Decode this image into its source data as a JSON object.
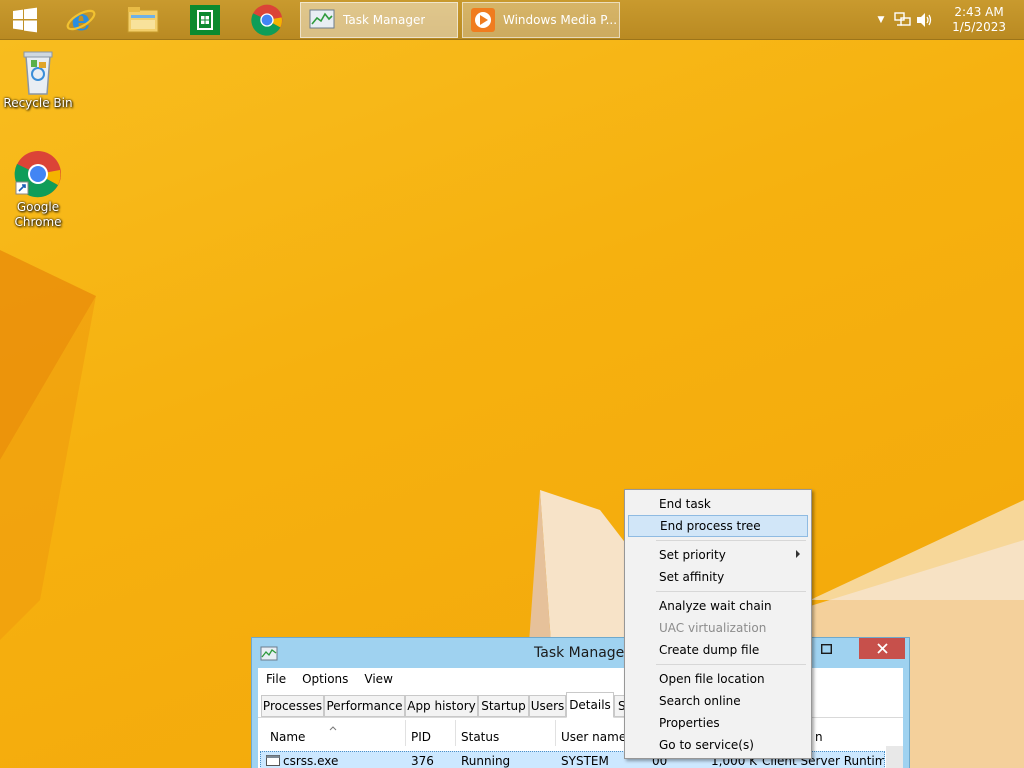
{
  "taskbar": {
    "start_icon": "windows-logo-icon",
    "pinned": [
      {
        "icon": "internet-explorer-icon"
      },
      {
        "icon": "file-explorer-icon"
      },
      {
        "icon": "windows-store-icon"
      },
      {
        "icon": "google-chrome-icon"
      }
    ],
    "tasks": [
      {
        "label": "Task Manager",
        "icon": "task-manager-icon"
      },
      {
        "label": "Windows Media P...",
        "icon": "media-player-icon"
      }
    ],
    "clock": {
      "time": "2:43 AM",
      "date": "1/5/2023"
    }
  },
  "desktop": {
    "icons": [
      {
        "label": "Recycle Bin",
        "icon": "recycle-bin-icon"
      },
      {
        "label": "Google Chrome",
        "icon": "google-chrome-icon"
      }
    ]
  },
  "task_manager": {
    "title": "Task Manager",
    "menu": [
      "File",
      "Options",
      "View"
    ],
    "tabs": [
      "Processes",
      "Performance",
      "App history",
      "Startup",
      "Users",
      "Details",
      "S"
    ],
    "selected_tab": "Details",
    "columns": [
      "Name",
      "PID",
      "Status",
      "User name",
      "n"
    ],
    "rows": [
      {
        "name": "csrss.exe",
        "pid": "376",
        "status": "Running",
        "user": "SYSTEM",
        "cpu": "00",
        "memory": "1,000 K",
        "description": "Client Server Runtim..."
      }
    ]
  },
  "context_menu": {
    "items": [
      {
        "label": "End task",
        "enabled": true
      },
      {
        "label": "End process tree",
        "enabled": true,
        "highlighted": true
      },
      {
        "label": "Set priority",
        "enabled": true,
        "submenu": true
      },
      {
        "label": "Set affinity",
        "enabled": true
      },
      {
        "label": "Analyze wait chain",
        "enabled": true
      },
      {
        "label": "UAC virtualization",
        "enabled": false
      },
      {
        "label": "Create dump file",
        "enabled": true
      },
      {
        "label": "Open file location",
        "enabled": true
      },
      {
        "label": "Search online",
        "enabled": true
      },
      {
        "label": "Properties",
        "enabled": true
      },
      {
        "label": "Go to service(s)",
        "enabled": true
      }
    ]
  },
  "colors": {
    "wallpaper": "#f6b10f",
    "taskbar": "#c3952a",
    "window_frame": "#9fd2f0",
    "close": "#c7504b",
    "menu_highlight": "#d1e6f8"
  }
}
